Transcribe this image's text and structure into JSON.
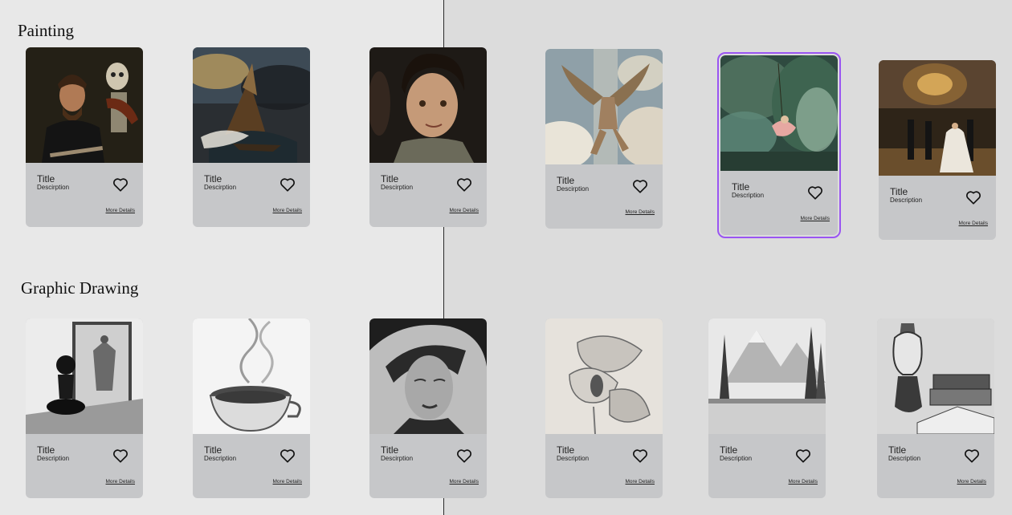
{
  "sections": {
    "painting": {
      "title": "Painting"
    },
    "drawing": {
      "title": "Graphic Drawing"
    }
  },
  "painting_cards": [
    {
      "title": "Title",
      "description": "Descirption",
      "link": "More Details",
      "image": "self-portrait-with-skeleton-violinist"
    },
    {
      "title": "Title",
      "description": "Descirption",
      "link": "More Details",
      "image": "ship-in-storm"
    },
    {
      "title": "Title",
      "description": "Descirption",
      "link": "More Details",
      "image": "curly-haired-young-man-portrait"
    },
    {
      "title": "Title",
      "description": "Descirption",
      "link": "More Details",
      "image": "winged-figure-in-clouds"
    },
    {
      "title": "Title",
      "description": "Description",
      "link": "More Details",
      "image": "woman-on-swing-in-garden"
    },
    {
      "title": "Title",
      "description": "Description",
      "link": "More Details",
      "image": "ballroom-dance"
    }
  ],
  "drawing_cards": [
    {
      "title": "Title",
      "description": "Description",
      "link": "More Details",
      "image": "chess-pawn-mirror-king"
    },
    {
      "title": "Title",
      "description": "Description",
      "link": "More Details",
      "image": "steaming-coffee-cup"
    },
    {
      "title": "Title",
      "description": "Descirption",
      "link": "More Details",
      "image": "woman-portrait-charcoal"
    },
    {
      "title": "Title",
      "description": "Description",
      "link": "More Details",
      "image": "calla-lilies"
    },
    {
      "title": "Title",
      "description": "Description",
      "link": "More Details",
      "image": "mountain-lake-pines"
    },
    {
      "title": "Title",
      "description": "Description",
      "link": "More Details",
      "image": "oil-lamp-and-books"
    }
  ],
  "selected_card": "woman-on-swing-in-garden",
  "colors": {
    "selection": "#9a55f2",
    "card": "#c6c7c9",
    "left_bg": "#e8e8e8",
    "right_bg": "#dcdcdc"
  }
}
